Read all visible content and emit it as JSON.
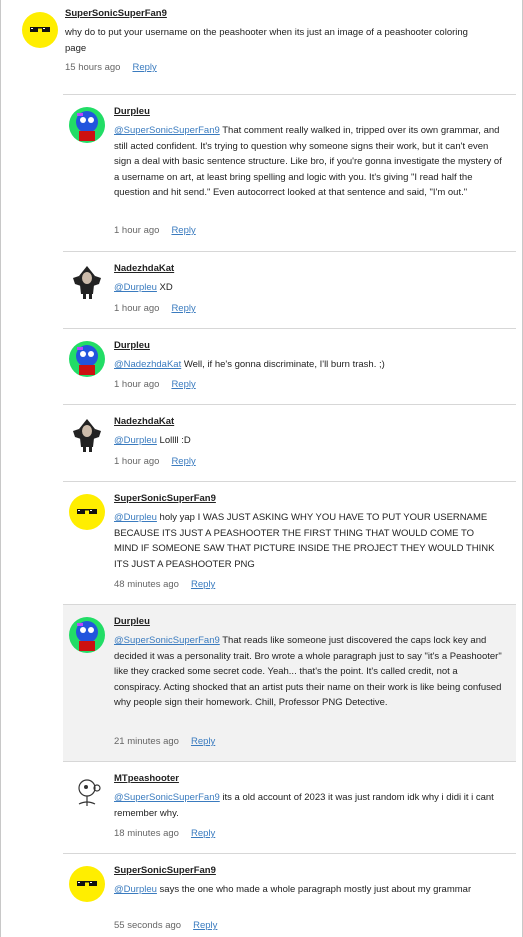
{
  "reply_label": "Reply",
  "colors": {
    "mention": "#3a7bbf",
    "yellow_avatar": "#ffee00",
    "highlight": "#f2f2f2"
  },
  "comments": [
    {
      "author": "SuperSonicSuperFan9",
      "avatar": "sunglasses-smiley",
      "mention": "",
      "text": "why do to put your username on the peashooter when its just an image of a peashooter coloring page",
      "time": "15 hours ago"
    },
    {
      "author": "Durpleu",
      "avatar": "durpleu",
      "mention": "@SuperSonicSuperFan9",
      "text": " That comment really walked in, tripped over its own grammar, and still acted confident. It's trying to question why someone signs their work, but it can't even sign a deal with basic sentence structure. Like bro, if you're gonna investigate the mystery of a username on art, at least bring spelling and logic with you. It's giving \"I read half the question and hit send.\" Even autocorrect looked at that sentence and said, \"I'm out.\"",
      "time": "1 hour ago"
    },
    {
      "author": "NadezhdaKat",
      "avatar": "nadezhdakat",
      "mention": "@Durpleu",
      "text": " XD",
      "time": "1 hour ago"
    },
    {
      "author": "Durpleu",
      "avatar": "durpleu",
      "mention": "@NadezhdaKat",
      "text": " Well, if he's gonna discriminate, I'll burn trash. ;)",
      "time": "1 hour ago"
    },
    {
      "author": "NadezhdaKat",
      "avatar": "nadezhdakat",
      "mention": "@Durpleu",
      "text": " Lollll :D",
      "time": "1 hour ago"
    },
    {
      "author": "SuperSonicSuperFan9",
      "avatar": "sunglasses-smiley",
      "mention": "@Durpleu",
      "text": " holy yap I WAS JUST ASKING WHY YOU HAVE TO PUT YOUR USERNAME BECAUSE ITS JUST A PEASHOOTER THE FIRST THING THAT WOULD COME TO MIND IF SOMEONE SAW THAT PICTURE INSIDE THE PROJECT THEY WOULD THINK ITS JUST A PEASHOOTER PNG",
      "time": "48 minutes ago"
    },
    {
      "author": "Durpleu",
      "avatar": "durpleu",
      "mention": "@SuperSonicSuperFan9",
      "text": " That reads like someone just discovered the caps lock key and decided it was a personality trait. Bro wrote a whole paragraph just to say \"it's a Peashooter\" like they cracked some secret code. Yeah... that's the point. It's called credit, not a conspiracy. Acting shocked that an artist puts their name on their work is like being confused why people sign their homework. Chill, Professor PNG Detective.",
      "time": "21 minutes ago"
    },
    {
      "author": "MTpeashooter",
      "avatar": "peashooter-sketch",
      "mention": "@SuperSonicSuperFan9",
      "text": " its a old account of 2023 it was just random idk why i didi it i cant remember why.",
      "time": "18 minutes ago"
    },
    {
      "author": "SuperSonicSuperFan9",
      "avatar": "sunglasses-smiley",
      "mention": "@Durpleu",
      "text": " says the one who made a whole paragraph mostly just about my grammar",
      "time": "55 seconds ago"
    }
  ]
}
